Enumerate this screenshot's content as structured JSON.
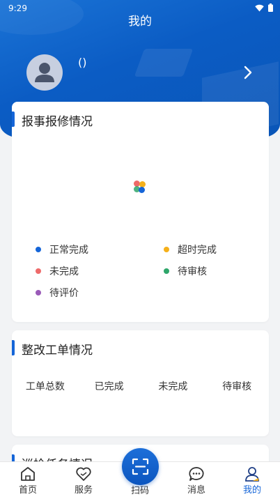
{
  "status_bar": {
    "time": "9:29"
  },
  "header": {
    "title": "我的",
    "username": "()"
  },
  "repair_card": {
    "title": "报事报修情况",
    "legend": [
      {
        "label": "正常完成",
        "color": "#1565d8"
      },
      {
        "label": "超时完成",
        "color": "#f5b01a"
      },
      {
        "label": "未完成",
        "color": "#ee6a6a"
      },
      {
        "label": "待审核",
        "color": "#2ea66a"
      },
      {
        "label": "待评价",
        "color": "#9a5ab8"
      }
    ]
  },
  "rectify_card": {
    "title": "整改工单情况",
    "columns": [
      "工单总数",
      "已完成",
      "未完成",
      "待审核"
    ]
  },
  "inspection_card": {
    "title": "巡检任务情况"
  },
  "tabbar": {
    "home": "首页",
    "service": "服务",
    "scan": "扫码",
    "messages": "消息",
    "mine": "我的"
  },
  "colors": {
    "accent": "#1565d8",
    "header": "#0b5cc4"
  }
}
